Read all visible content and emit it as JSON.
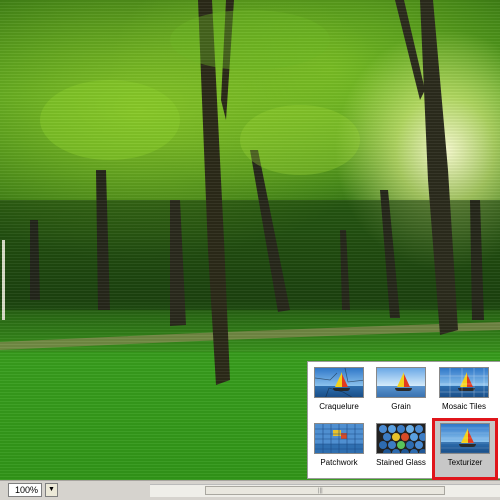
{
  "canvas": {
    "description_icon": "forest-photo"
  },
  "statusbar": {
    "zoom_value": "100%",
    "zoom_button_glyph": "▼",
    "scroll_grip": "|||"
  },
  "filter_gallery": {
    "items": [
      {
        "label": "Craquelure"
      },
      {
        "label": "Grain"
      },
      {
        "label": "Mosaic Tiles"
      },
      {
        "label": "Patchwork"
      },
      {
        "label": "Stained Glass"
      },
      {
        "label": "Texturizer",
        "selected": true
      }
    ],
    "highlight_color": "#e0151b"
  }
}
